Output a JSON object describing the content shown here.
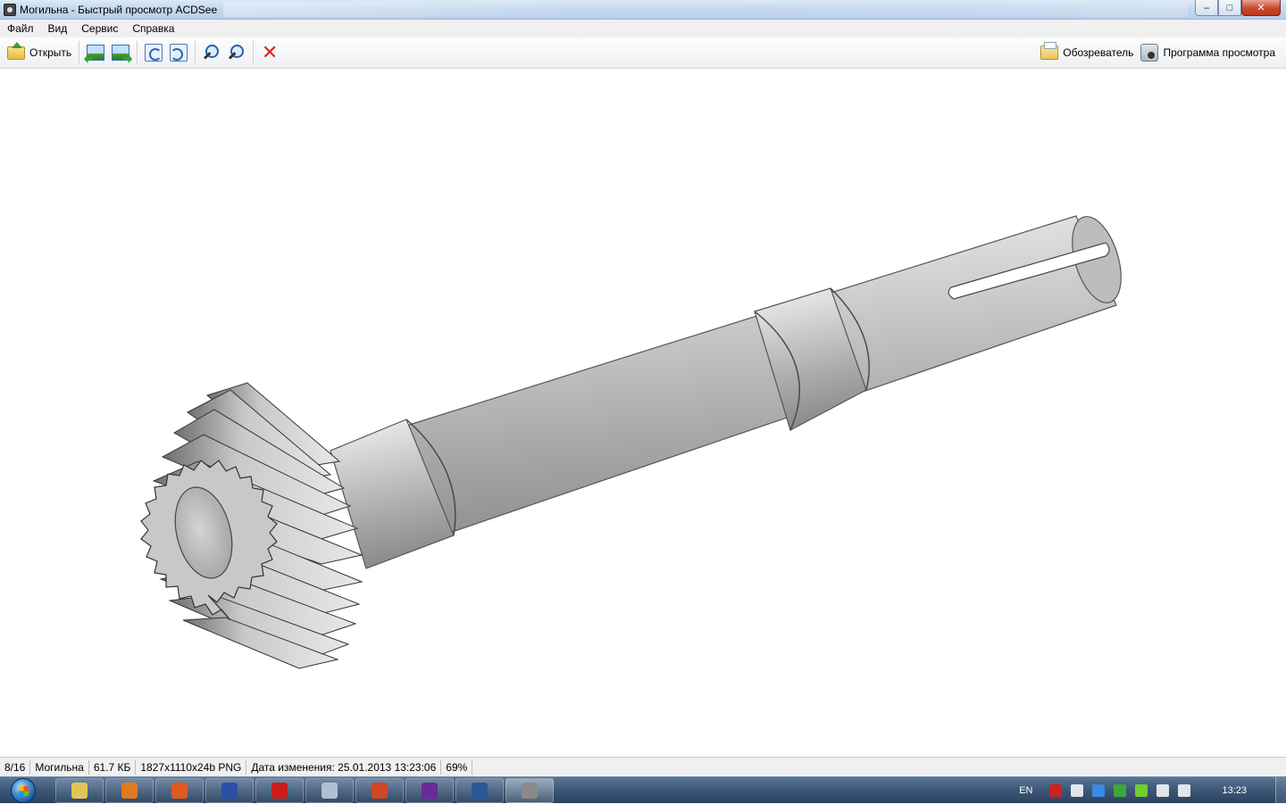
{
  "window": {
    "title": "Могильна - Быстрый просмотр ACDSee",
    "minimize_label": "–",
    "maximize_label": "□",
    "close_label": "✕"
  },
  "menu": [
    {
      "label": "Файл"
    },
    {
      "label": "Вид"
    },
    {
      "label": "Сервис"
    },
    {
      "label": "Справка"
    }
  ],
  "toolbar": {
    "open_label": "Открыть",
    "browser_label": "Обозреватель",
    "viewer_label": "Программа просмотра"
  },
  "status": {
    "position": "8/16",
    "filename": "Могильна",
    "filesize": "61.7 КБ",
    "dimensions": "1827x1110x24b PNG",
    "modified": "Дата изменения: 25.01.2013 13:23:06",
    "zoom": "69%"
  },
  "taskbar": {
    "lang": "EN",
    "clock": "13:23",
    "apps": [
      {
        "name": "explorer",
        "color": "#e2c35a"
      },
      {
        "name": "media-player",
        "color": "#e07a1f"
      },
      {
        "name": "firefox",
        "color": "#e05a1f"
      },
      {
        "name": "floppy-app",
        "color": "#2c4fa8"
      },
      {
        "name": "opera",
        "color": "#cc1b1b"
      },
      {
        "name": "calculator",
        "color": "#b0c0d0"
      },
      {
        "name": "powerpoint",
        "color": "#d24726"
      },
      {
        "name": "mathcad",
        "color": "#6a2a9a"
      },
      {
        "name": "word",
        "color": "#2b5797"
      },
      {
        "name": "acdsee",
        "color": "#8a8a8a"
      }
    ],
    "tray": [
      {
        "name": "acrobat",
        "color": "#cc2222"
      },
      {
        "name": "action-center",
        "color": "#ffffff"
      },
      {
        "name": "network-app",
        "color": "#3a8be0"
      },
      {
        "name": "antivirus",
        "color": "#3ca83c"
      },
      {
        "name": "utorrent",
        "color": "#6fcf2f"
      },
      {
        "name": "sound",
        "color": "#ffffff"
      },
      {
        "name": "network",
        "color": "#ffffff"
      }
    ]
  }
}
